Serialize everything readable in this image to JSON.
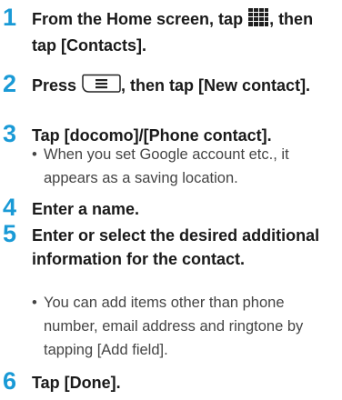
{
  "steps": [
    {
      "num": "1",
      "parts": [
        "From the Home screen, tap ",
        ", then tap [Contacts]."
      ],
      "icon": "apps-grid-icon"
    },
    {
      "num": "2",
      "parts": [
        "Press ",
        ", then tap [New contact]."
      ],
      "icon": "menu-key-icon"
    },
    {
      "num": "3",
      "title": "Tap [docomo]/[Phone contact].",
      "note": "When you set Google account etc., it appears as a saving location."
    },
    {
      "num": "4",
      "title": "Enter a name."
    },
    {
      "num": "5",
      "title": "Enter or select the desired additional information for the contact.",
      "note": "You can add items other than phone number, email address and ringtone by tapping [Add field]."
    },
    {
      "num": "6",
      "title": "Tap [Done]."
    }
  ],
  "bullet": "•",
  "accent_color": "#1a9ad6"
}
